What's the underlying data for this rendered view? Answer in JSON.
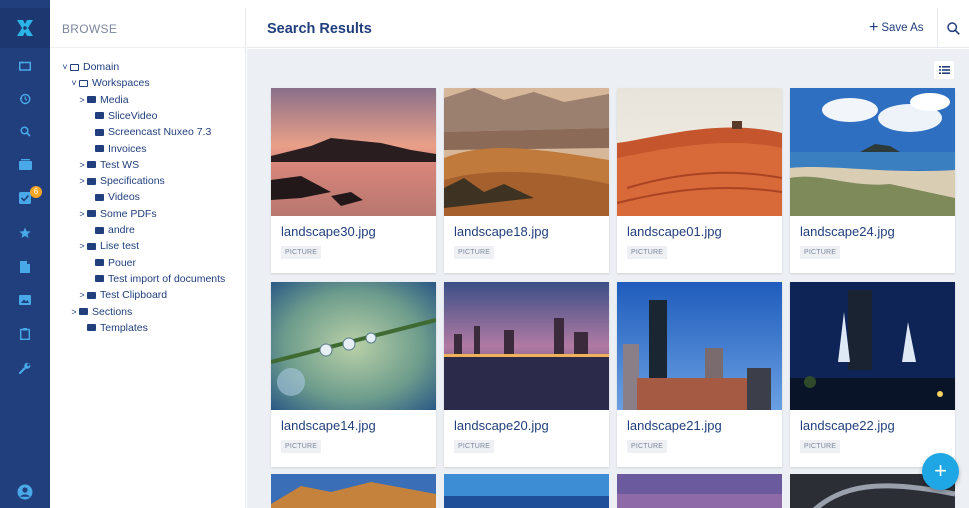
{
  "app": {
    "logo": "nuxeo-x-logo"
  },
  "rail": {
    "items": [
      {
        "icon": "folder-icon"
      },
      {
        "icon": "history-icon"
      },
      {
        "icon": "search-icon"
      },
      {
        "icon": "collections-icon"
      },
      {
        "icon": "tasks-icon",
        "badge": "6"
      },
      {
        "icon": "star-icon"
      },
      {
        "icon": "clipboard-icon"
      },
      {
        "icon": "image-icon"
      },
      {
        "icon": "document-icon"
      },
      {
        "icon": "wrench-icon"
      }
    ],
    "user_icon": "user-avatar-icon"
  },
  "browse": {
    "header": "BROWSE",
    "tree": [
      {
        "label": "Domain",
        "chevron": "˅",
        "open": true
      },
      {
        "label": "Workspaces",
        "chevron": "˅",
        "open": true
      },
      {
        "label": "Media",
        "chevron": ">",
        "open": false
      },
      {
        "label": "SliceVideo",
        "chevron": "",
        "open": false
      },
      {
        "label": "Screencast Nuxeo 7.3",
        "chevron": "",
        "open": false
      },
      {
        "label": "Invoices",
        "chevron": "",
        "open": false
      },
      {
        "label": "Test WS",
        "chevron": ">",
        "open": false
      },
      {
        "label": "Specifications",
        "chevron": ">",
        "open": false
      },
      {
        "label": "Videos",
        "chevron": "",
        "open": false
      },
      {
        "label": "Some PDFs",
        "chevron": ">",
        "open": false
      },
      {
        "label": "andre",
        "chevron": "",
        "open": false
      },
      {
        "label": "Lise test",
        "chevron": ">",
        "open": false
      },
      {
        "label": "Pouer",
        "chevron": "",
        "open": false
      },
      {
        "label": "Test import of documents",
        "chevron": "",
        "open": false
      },
      {
        "label": "Test Clipboard",
        "chevron": ">",
        "open": false
      },
      {
        "label": "Sections",
        "chevron": ">",
        "open": false
      },
      {
        "label": "Templates",
        "chevron": "",
        "open": false
      }
    ]
  },
  "header": {
    "title": "Search Results",
    "save_as_plus": "+",
    "save_as": "Save As"
  },
  "results": [
    {
      "name": "landscape30.jpg",
      "type": "PICTURE"
    },
    {
      "name": "landscape18.jpg",
      "type": "PICTURE"
    },
    {
      "name": "landscape01.jpg",
      "type": "PICTURE"
    },
    {
      "name": "landscape24.jpg",
      "type": "PICTURE"
    },
    {
      "name": "landscape14.jpg",
      "type": "PICTURE"
    },
    {
      "name": "landscape20.jpg",
      "type": "PICTURE"
    },
    {
      "name": "landscape21.jpg",
      "type": "PICTURE"
    },
    {
      "name": "landscape22.jpg",
      "type": "PICTURE"
    }
  ],
  "fab": "+",
  "colors": {
    "brand": "#213f7d",
    "accent": "#1ea7e4",
    "badge": "#f5a623",
    "background": "#eceff3"
  }
}
